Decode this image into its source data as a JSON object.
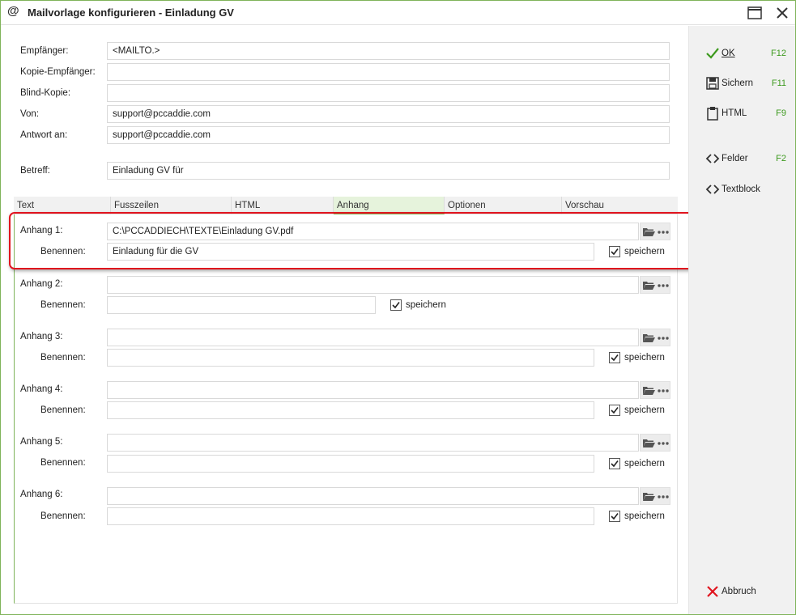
{
  "window": {
    "title": "Mailvorlage konfigurieren - Einladung GV",
    "app_icon": "at-icon"
  },
  "header": {
    "recipient": {
      "label": "Empfänger:",
      "value": "<MAILTO.>"
    },
    "cc": {
      "label": "Kopie-Empfänger:",
      "value": ""
    },
    "bcc": {
      "label": "Blind-Kopie:",
      "value": ""
    },
    "from": {
      "label": "Von:",
      "value": "support@pccaddie.com"
    },
    "reply_to": {
      "label": "Antwort an:",
      "value": "support@pccaddie.com"
    },
    "subject": {
      "label": "Betreff:",
      "value": "Einladung GV für"
    }
  },
  "tabs": [
    {
      "label": "Text"
    },
    {
      "label": "Fusszeilen"
    },
    {
      "label": "HTML"
    },
    {
      "label": "Anhang",
      "active": true
    },
    {
      "label": "Optionen"
    },
    {
      "label": "Vorschau"
    }
  ],
  "attachments": [
    {
      "label": "Anhang 1:",
      "path": "C:\\PCCADDIECH\\TEXTE\\Einladung GV.pdf",
      "name_label": "Benennen:",
      "name": "Einladung für die GV",
      "save_label": "speichern",
      "save_checked": true
    },
    {
      "label": "Anhang 2:",
      "path": "",
      "name_label": "Benennen:",
      "name": "",
      "save_label": "speichern",
      "save_checked": true
    },
    {
      "label": "Anhang 3:",
      "path": "",
      "name_label": "Benennen:",
      "name": "",
      "save_label": "speichern",
      "save_checked": true
    },
    {
      "label": "Anhang 4:",
      "path": "",
      "name_label": "Benennen:",
      "name": "",
      "save_label": "speichern",
      "save_checked": true
    },
    {
      "label": "Anhang 5:",
      "path": "",
      "name_label": "Benennen:",
      "name": "",
      "save_label": "speichern",
      "save_checked": true
    },
    {
      "label": "Anhang 6:",
      "path": "",
      "name_label": "Benennen:",
      "name": "",
      "save_label": "speichern",
      "save_checked": true
    }
  ],
  "sidebar": {
    "ok": {
      "label": "OK",
      "key": "F12"
    },
    "save": {
      "label": "Sichern",
      "key": "F11"
    },
    "html": {
      "label": "HTML",
      "key": "F9"
    },
    "fields": {
      "label": "Felder",
      "key": "F2"
    },
    "textblock": {
      "label": "Textblock",
      "key": ""
    },
    "cancel": {
      "label": "Abbruch",
      "key": ""
    }
  },
  "colors": {
    "accent": "#7fb35a",
    "highlight": "#e0141e",
    "hotkey": "#3d9a1e",
    "cancel": "#e0141e"
  }
}
